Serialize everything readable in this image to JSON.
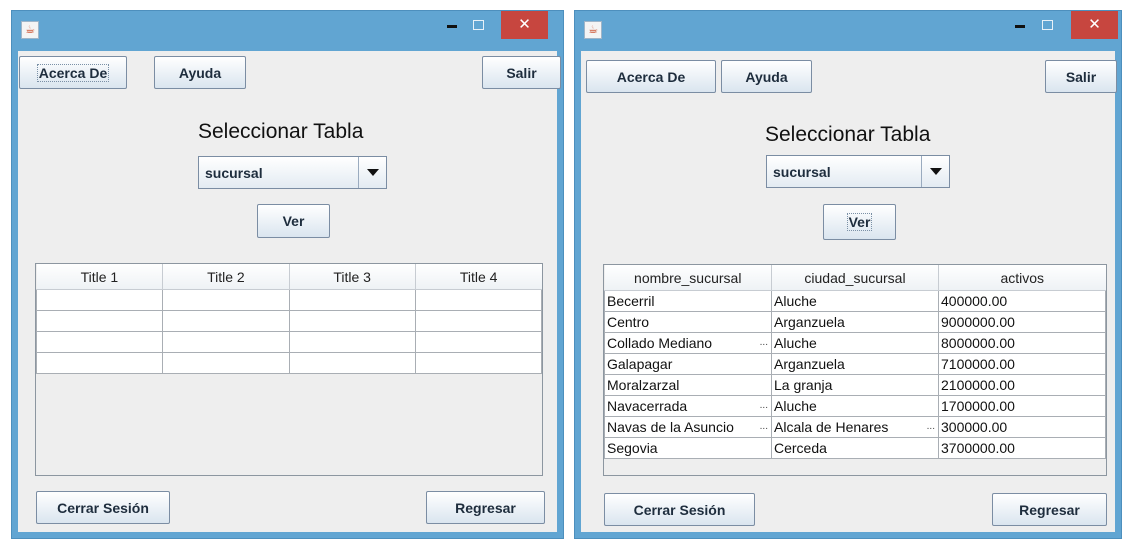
{
  "window1": {
    "menu": {
      "about": "Acerca De",
      "help": "Ayuda",
      "exit": "Salir"
    },
    "select_title": "Seleccionar Tabla",
    "selected_table": "sucursal",
    "view_button": "Ver",
    "table": {
      "headers": [
        "Title 1",
        "Title 2",
        "Title 3",
        "Title 4"
      ],
      "rows": [
        [
          "",
          "",
          "",
          ""
        ],
        [
          "",
          "",
          "",
          ""
        ],
        [
          "",
          "",
          "",
          ""
        ],
        [
          "",
          "",
          "",
          ""
        ]
      ]
    },
    "footer": {
      "logout": "Cerrar Sesión",
      "back": "Regresar"
    }
  },
  "window2": {
    "menu": {
      "about": "Acerca De",
      "help": "Ayuda",
      "exit": "Salir"
    },
    "select_title": "Seleccionar Tabla",
    "selected_table": "sucursal",
    "view_button": "Ver",
    "table": {
      "headers": [
        "nombre_sucursal",
        "ciudad_sucursal",
        "activos"
      ],
      "rows": [
        [
          "Becerril",
          "Aluche",
          "400000.00"
        ],
        [
          "Centro",
          "Arganzuela",
          "9000000.00"
        ],
        [
          "Collado Mediano",
          "Aluche",
          "8000000.00"
        ],
        [
          "Galapagar",
          "Arganzuela",
          "7100000.00"
        ],
        [
          "Moralzarzal",
          "La granja",
          "2100000.00"
        ],
        [
          "Navacerrada",
          "Aluche",
          "1700000.00"
        ],
        [
          "Navas de la Asuncio",
          "Alcala de Henares",
          "300000.00"
        ],
        [
          "Segovia",
          "Cerceda",
          "3700000.00"
        ]
      ]
    },
    "footer": {
      "logout": "Cerrar Sesión",
      "back": "Regresar"
    }
  },
  "colors": {
    "titlebar": "#61a5d2",
    "close_button": "#c7463f",
    "panel": "#eeeeee"
  },
  "icons": {
    "app": "java-cup-icon",
    "minimize": "minimize-icon",
    "maximize": "maximize-icon",
    "close": "close-icon"
  }
}
